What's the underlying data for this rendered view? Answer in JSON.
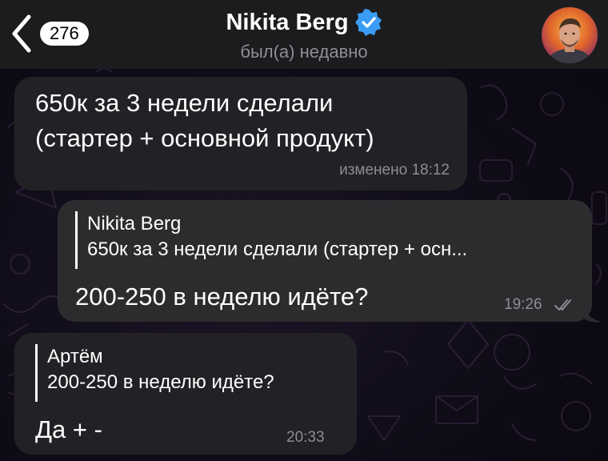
{
  "header": {
    "back_badge": "276",
    "contact_name": "Nikita Berg",
    "contact_status": "был(а) недавно"
  },
  "messages": [
    {
      "direction": "incoming",
      "lines": [
        "650к за 3 недели сделали",
        "(стартер + основной продукт)"
      ],
      "meta": "изменено 18:12"
    },
    {
      "direction": "outgoing",
      "reply_name": "Nikita Berg",
      "reply_text": "650к за 3 недели сделали (стартер + осн...",
      "text": "200-250 в неделю идёте?",
      "time": "19:26",
      "status": "read"
    },
    {
      "direction": "incoming",
      "reply_name": "Артём",
      "reply_text": "200-250 в неделю идёте?",
      "text": "Да + -",
      "time": "20:33"
    }
  ],
  "colors": {
    "header_bg": "#1c1c1e",
    "bubble_incoming": "#222125",
    "bubble_outgoing": "#2c2c2e",
    "verified": "#3a9df5"
  },
  "icons": {
    "back": "chevron-left-icon",
    "verified": "verified-badge-icon",
    "read": "double-check-icon"
  }
}
